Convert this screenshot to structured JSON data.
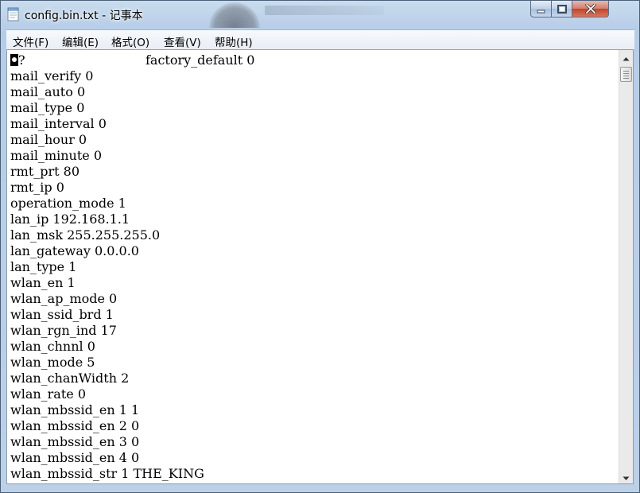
{
  "window": {
    "title": "config.bin.txt - 记事本",
    "icons": {
      "app": "notepad-icon",
      "minimize": "minimize-icon",
      "maximize": "maximize-icon",
      "close": "close-icon"
    },
    "colors": {
      "close_button": "#c0452e",
      "frame": "#bcd0e8"
    }
  },
  "menu": {
    "file": "文件(F)",
    "edit": "编辑(E)",
    "format": "格式(O)",
    "view": "查看(V)",
    "help": "帮助(H)"
  },
  "document": {
    "first_line": {
      "prefix": "?",
      "text": "factory_default 0"
    },
    "lines": [
      "mail_verify 0",
      "mail_auto 0",
      "mail_type 0",
      "mail_interval 0",
      "mail_hour 0",
      "mail_minute 0",
      "rmt_prt 80",
      "rmt_ip 0",
      "operation_mode 1",
      "lan_ip 192.168.1.1",
      "lan_msk 255.255.255.0",
      "lan_gateway 0.0.0.0",
      "lan_type 1",
      "wlan_en 1",
      "wlan_ap_mode 0",
      "wlan_ssid_brd 1",
      "wlan_rgn_ind 17",
      "wlan_chnnl 0",
      "wlan_mode 5",
      "wlan_chanWidth 2",
      "wlan_rate 0",
      "wlan_mbssid_en 1 1",
      "wlan_mbssid_en 2 0",
      "wlan_mbssid_en 3 0",
      "wlan_mbssid_en 4 0",
      "wlan_mbssid_str 1 THE_KING"
    ]
  },
  "scrollbar": {
    "up": "scroll-up-arrow-icon",
    "down": "scroll-down-arrow-icon",
    "position": 0.0
  }
}
